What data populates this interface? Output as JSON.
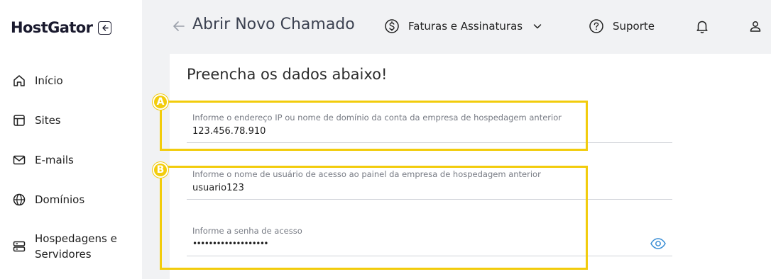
{
  "brand": {
    "logo_text": "HostGator"
  },
  "sidebar": {
    "items": [
      {
        "label": "Início",
        "icon": "home-icon"
      },
      {
        "label": "Sites",
        "icon": "layout-icon"
      },
      {
        "label": "E-mails",
        "icon": "mail-icon"
      },
      {
        "label": "Domínios",
        "icon": "globe-icon"
      },
      {
        "label_line1": "Hospedagens e",
        "label_line2": "Servidores",
        "icon": "server-icon"
      }
    ]
  },
  "header": {
    "title": "Abrir Novo Chamado",
    "billing_label": "Faturas e Assinaturas",
    "support_label": "Suporte"
  },
  "form": {
    "heading": "Preencha os dados abaixo!",
    "fields": [
      {
        "label": "Informe o endereço IP ou nome de domínio da conta da empresa de hospedagem anterior",
        "value": "123.456.78.910"
      },
      {
        "label": "Informe o nome de usuário de acesso ao painel da empresa de hospedagem anterior",
        "value": "usuario123"
      },
      {
        "label": "Informe a senha de acesso",
        "value": "•••••••••••••••••••"
      }
    ]
  },
  "annotations": {
    "a": "A",
    "b": "B",
    "color": "#f2cc0c"
  },
  "colors": {
    "accent": "#3b8fd6",
    "topbar_bg": "#f1f2f4"
  }
}
